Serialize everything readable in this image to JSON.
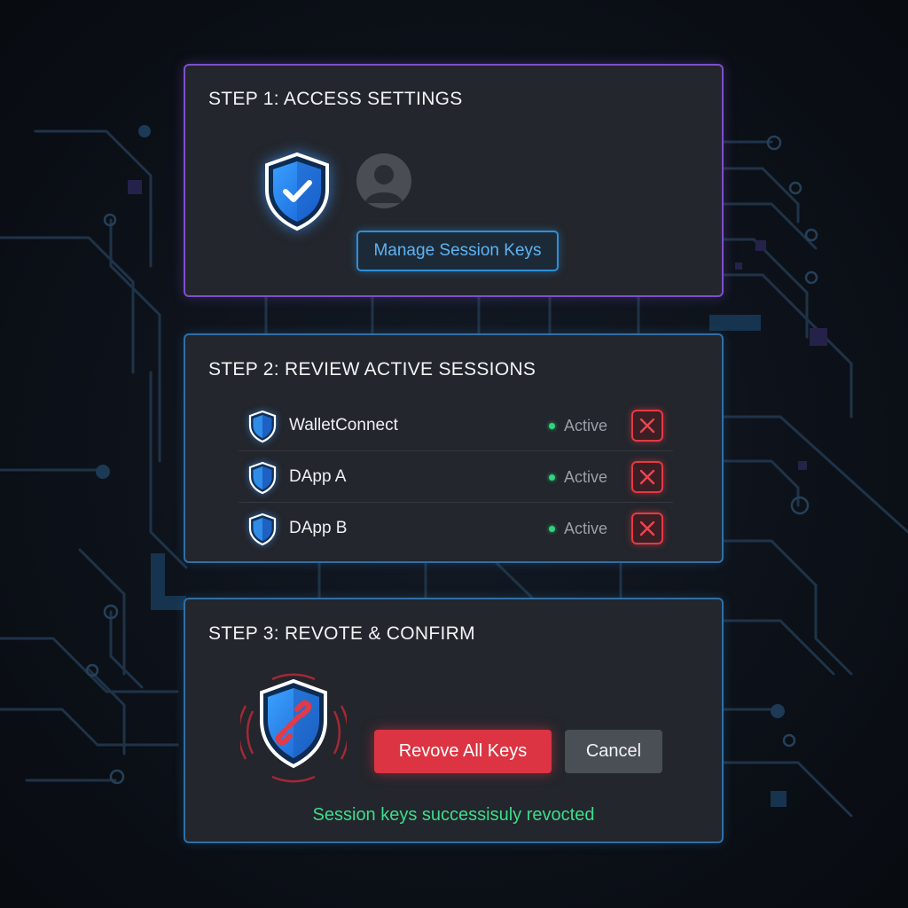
{
  "steps": [
    {
      "title": "STEP 1: ACCESS SETTINGS",
      "manage_button": "Manage Session Keys"
    },
    {
      "title": "STEP 2: REVIEW ACTIVE SESSIONS",
      "sessions": [
        {
          "name": "WalletConnect",
          "status": "Active"
        },
        {
          "name": "DApp A",
          "status": "Active"
        },
        {
          "name": "DApp B",
          "status": "Active"
        }
      ]
    },
    {
      "title": "STEP 3: REVOTE & CONFIRM",
      "revoke_all_button": "Revove All Keys",
      "cancel_button": "Cancel",
      "success_message": "Session keys successisuly revocted"
    }
  ],
  "icons": {
    "verified": "shield-check-icon",
    "profile": "user-avatar-icon",
    "session": "shield-icon",
    "revoke": "close-icon",
    "revoked": "shield-broken-link-icon"
  },
  "colors": {
    "panel_bg": "#23262c",
    "step1_border": "#7c4fc9",
    "panel_border": "#2f6fa8",
    "accent_blue": "#2e8fd8",
    "danger": "#dc3442",
    "success": "#3ddc8b",
    "active_dot": "#2fd47f"
  }
}
